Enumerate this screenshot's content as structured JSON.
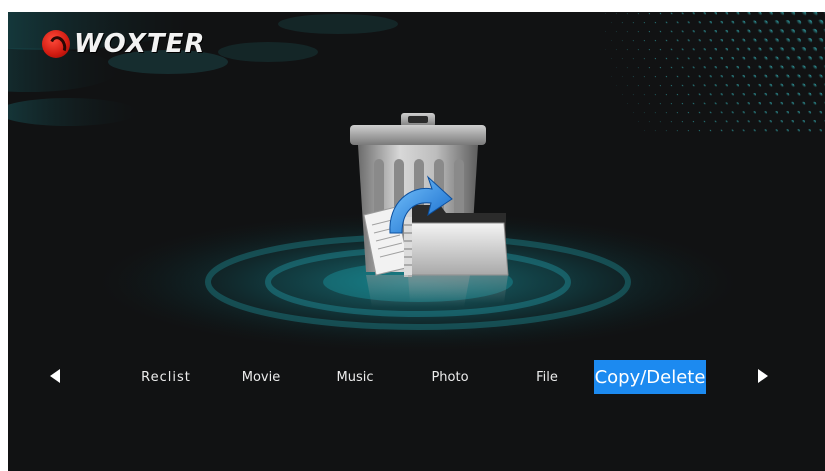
{
  "brand": {
    "logo_text": "WOXTER",
    "logo_icon": "woxter-logo-icon"
  },
  "center_icon": {
    "name": "copy-delete-icon"
  },
  "menu": {
    "prev_icon": "arrow-left-icon",
    "next_icon": "arrow-right-icon",
    "selected_index": 5,
    "items": [
      {
        "label": "Reclist"
      },
      {
        "label": "Movie"
      },
      {
        "label": "Music"
      },
      {
        "label": "Photo"
      },
      {
        "label": "File"
      },
      {
        "label": "Copy/Delete"
      }
    ]
  },
  "colors": {
    "background": "#111213",
    "accent_teal": "#1fb3c0",
    "selection_blue": "#1c8af0",
    "text": "#ececec"
  }
}
